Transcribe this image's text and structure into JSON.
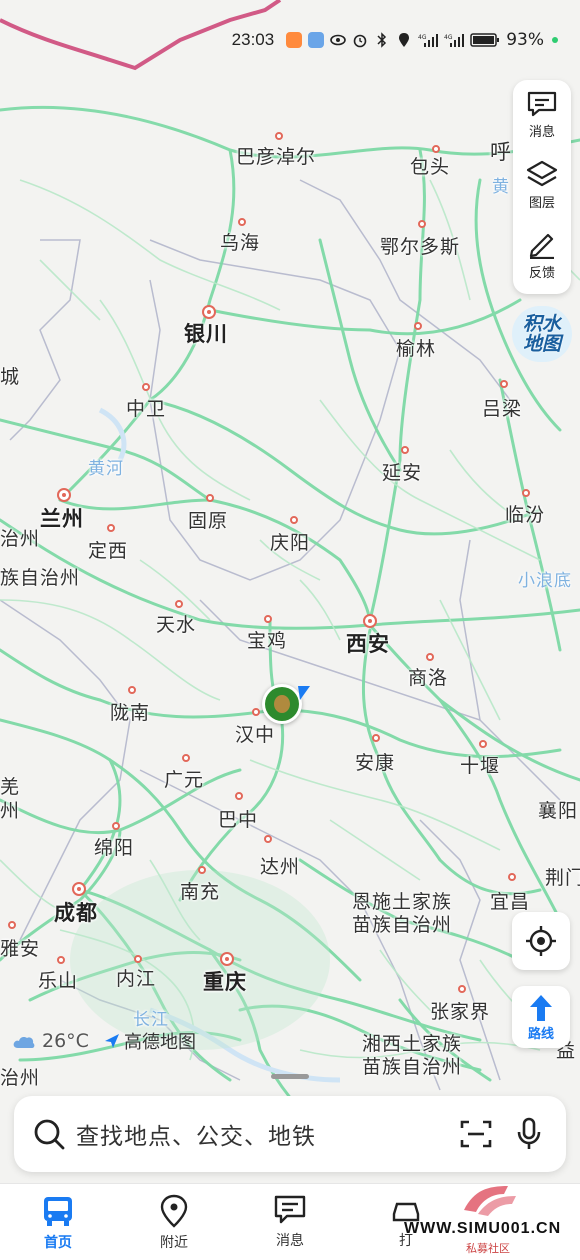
{
  "status": {
    "time": "23:03",
    "battery": "93%"
  },
  "right_panel": {
    "message": "消息",
    "layers": "图层",
    "feedback": "反馈"
  },
  "flood_map": "积水地图",
  "map_labels": {
    "badanjilin": "巴彦淖尔",
    "baotou": "包头",
    "hu": "呼",
    "huang_top": "黄",
    "wuhai": "乌海",
    "ordos": "鄂尔多斯",
    "yinchuan": "银川",
    "yulin": "榆林",
    "zhongwei": "中卫",
    "lvliang": "吕梁",
    "yellow_river": "黄河",
    "yanan": "延安",
    "lanzhou": "兰州",
    "guyuan": "固原",
    "linfen": "临汾",
    "dingxi": "定西",
    "qingyang": "庆阳",
    "zhi": "治州",
    "cheng": "城",
    "zu_zhou": "族自治州",
    "xiaolangdi": "小浪底",
    "tianshui": "天水",
    "baoji": "宝鸡",
    "xian": "西安",
    "shangluo": "商洛",
    "longnan": "陇南",
    "hanzhong": "汉中",
    "ankang": "安康",
    "shiyan": "十堰",
    "guangyuan": "广元",
    "qiang": "羌",
    "zhou": "州",
    "bazhong": "巴中",
    "xiangyang": "襄阳",
    "mianyang": "绵阳",
    "dazhou": "达州",
    "jingmen": "荆门",
    "nanchong": "南充",
    "chengdu": "成都",
    "enshi1": "恩施土家族",
    "enshi2": "苗族自治州",
    "yichang": "宜昌",
    "yaan": "雅安",
    "leshan": "乐山",
    "neijiang": "内江",
    "chongqing": "重庆",
    "zhangjiajie": "张家界",
    "changjiang": "长江",
    "xiangxi1": "湘西土家族",
    "xiangxi2": "苗族自治州",
    "yi": "益",
    "zhizhou_bottom": "治州"
  },
  "weather": {
    "temp": "26°C",
    "brand": "高德地图"
  },
  "route_btn": "路线",
  "search": {
    "placeholder": "查找地点、公交、地铁"
  },
  "tabs": [
    {
      "label": "首页",
      "active": true
    },
    {
      "label": "附近"
    },
    {
      "label": "消息"
    },
    {
      "label": "打"
    }
  ],
  "watermark": {
    "url": "WWW.SIMU001.CN",
    "sub": "私募社区"
  },
  "colors": {
    "road": "#7ed9a6",
    "accent": "#1a7bf2",
    "border": "#d15a86"
  }
}
